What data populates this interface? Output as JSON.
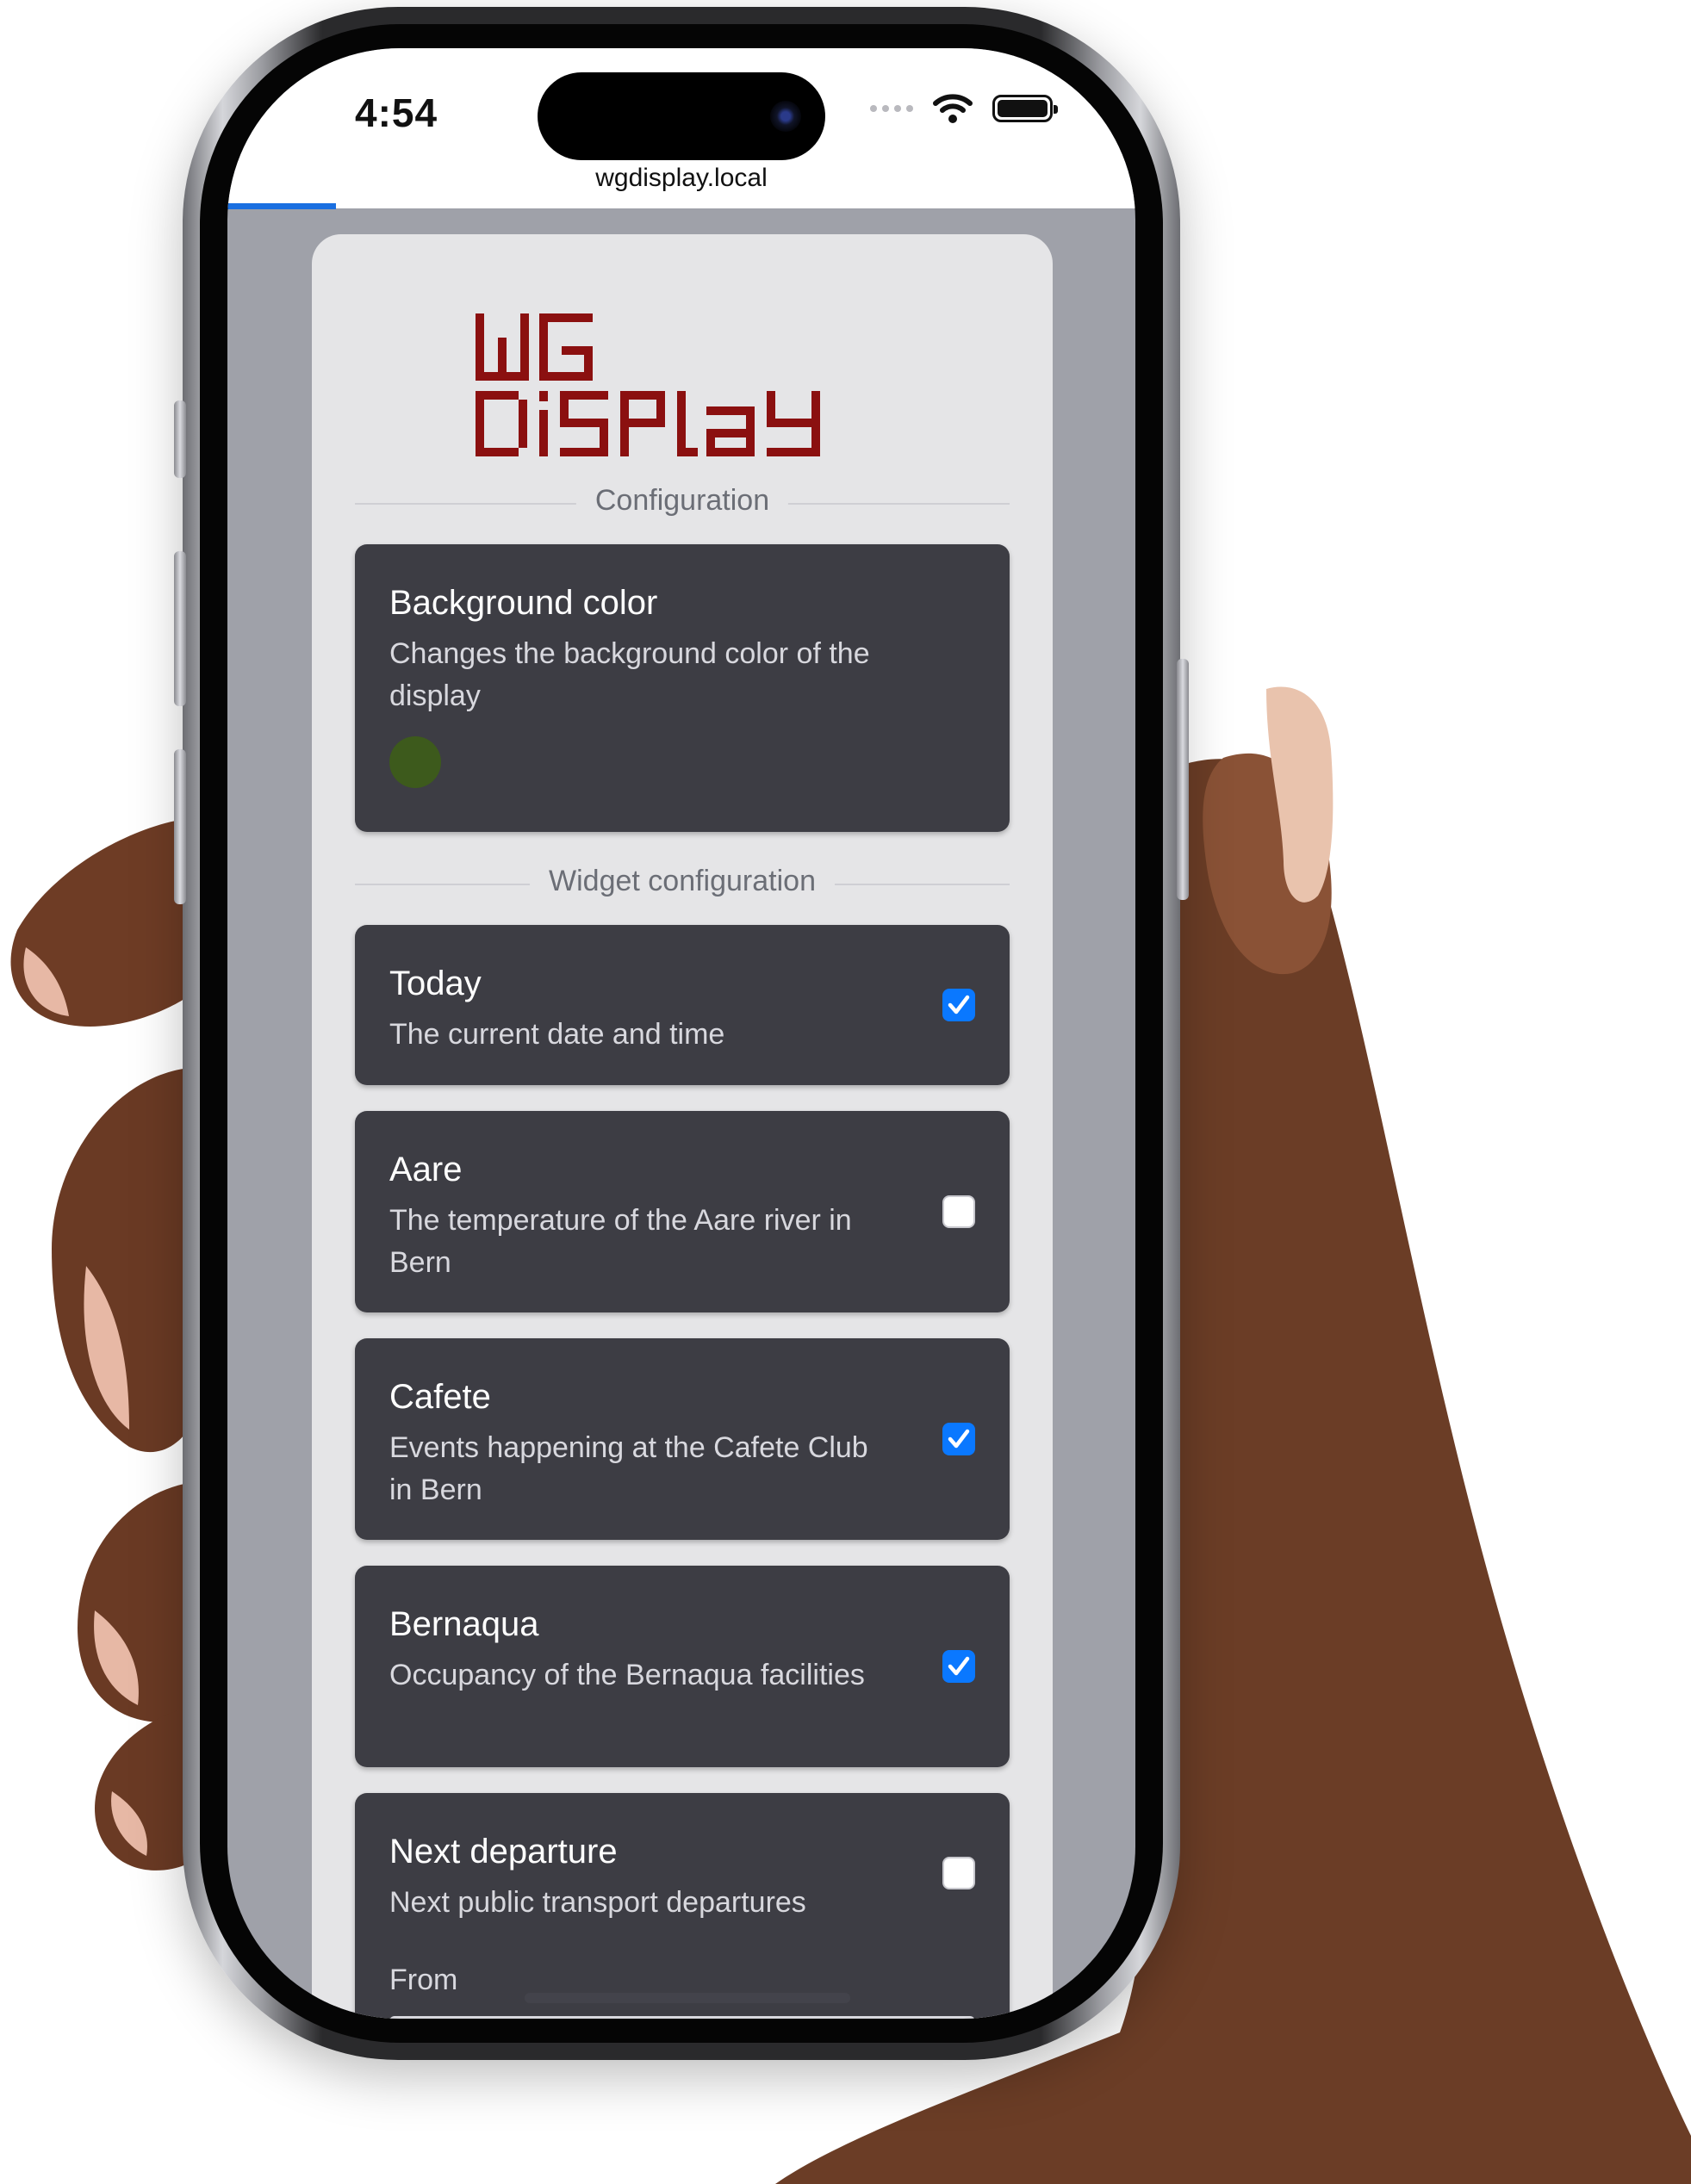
{
  "status_bar": {
    "time": "4:54"
  },
  "browser": {
    "url": "wgdisplay.local",
    "progress_fraction": 0.12
  },
  "logo": {
    "line1": "WG",
    "line2": "DiSPlaY",
    "color": "#8b1010"
  },
  "sections": {
    "configuration": "Configuration",
    "widget_configuration": "Widget configuration"
  },
  "background_color": {
    "title": "Background color",
    "description": "Changes the background color of the display",
    "value": "#3d5a1c"
  },
  "widgets": [
    {
      "title": "Today",
      "description": "The current date and time",
      "enabled": true
    },
    {
      "title": "Aare",
      "description": "The temperature of the Aare river in Bern",
      "enabled": false
    },
    {
      "title": "Cafete",
      "description": "Events happening at the Cafete Club in Bern",
      "enabled": true
    },
    {
      "title": "Bernaqua",
      "description": "Occupancy of the Bernaqua facilities",
      "enabled": true
    },
    {
      "title": "Next departure",
      "description": "Next public transport departures",
      "enabled": false,
      "field_label": "From"
    }
  ],
  "colors": {
    "checkbox_on": "#0a78ff",
    "card": "#3d3d44",
    "page": "#e5e5e7"
  }
}
